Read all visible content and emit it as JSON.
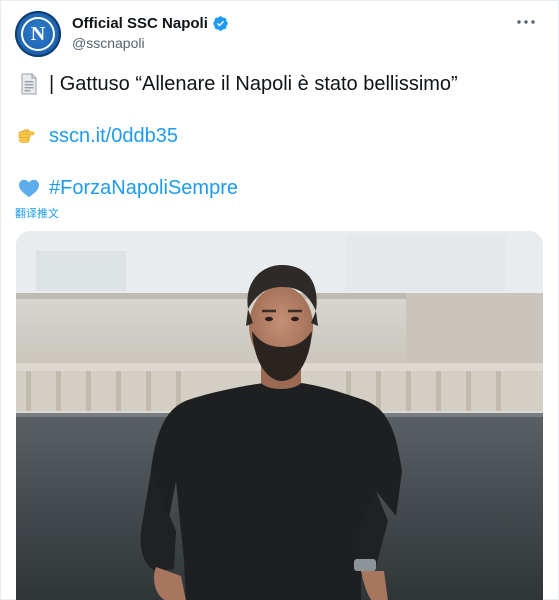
{
  "account": {
    "display_name": "Official SSC Napoli",
    "handle": "@sscnapoli",
    "verified": true,
    "avatar_icon": "ssc-napoli-logo",
    "avatar_letter": "N"
  },
  "tweet": {
    "headline": "| Gattuso “Allenare il Napoli è stato bellissimo”",
    "headline_icon": "page-facing-up-emoji",
    "link_icon": "backhand-index-pointing-right-emoji",
    "link_text": "sscn.it/0ddb35",
    "hashtag_icon": "blue-heart-emoji",
    "hashtag_text": "#ForzaNapoliSempre",
    "translate_label": "翻译推文"
  },
  "media": {
    "icon": "photo-gattuso-training"
  },
  "colors": {
    "link": "#1d9bf0",
    "verified": "#1d9bf0",
    "avatar": "#1b5fa8",
    "text": "#0f1419",
    "secondary": "#536471"
  }
}
